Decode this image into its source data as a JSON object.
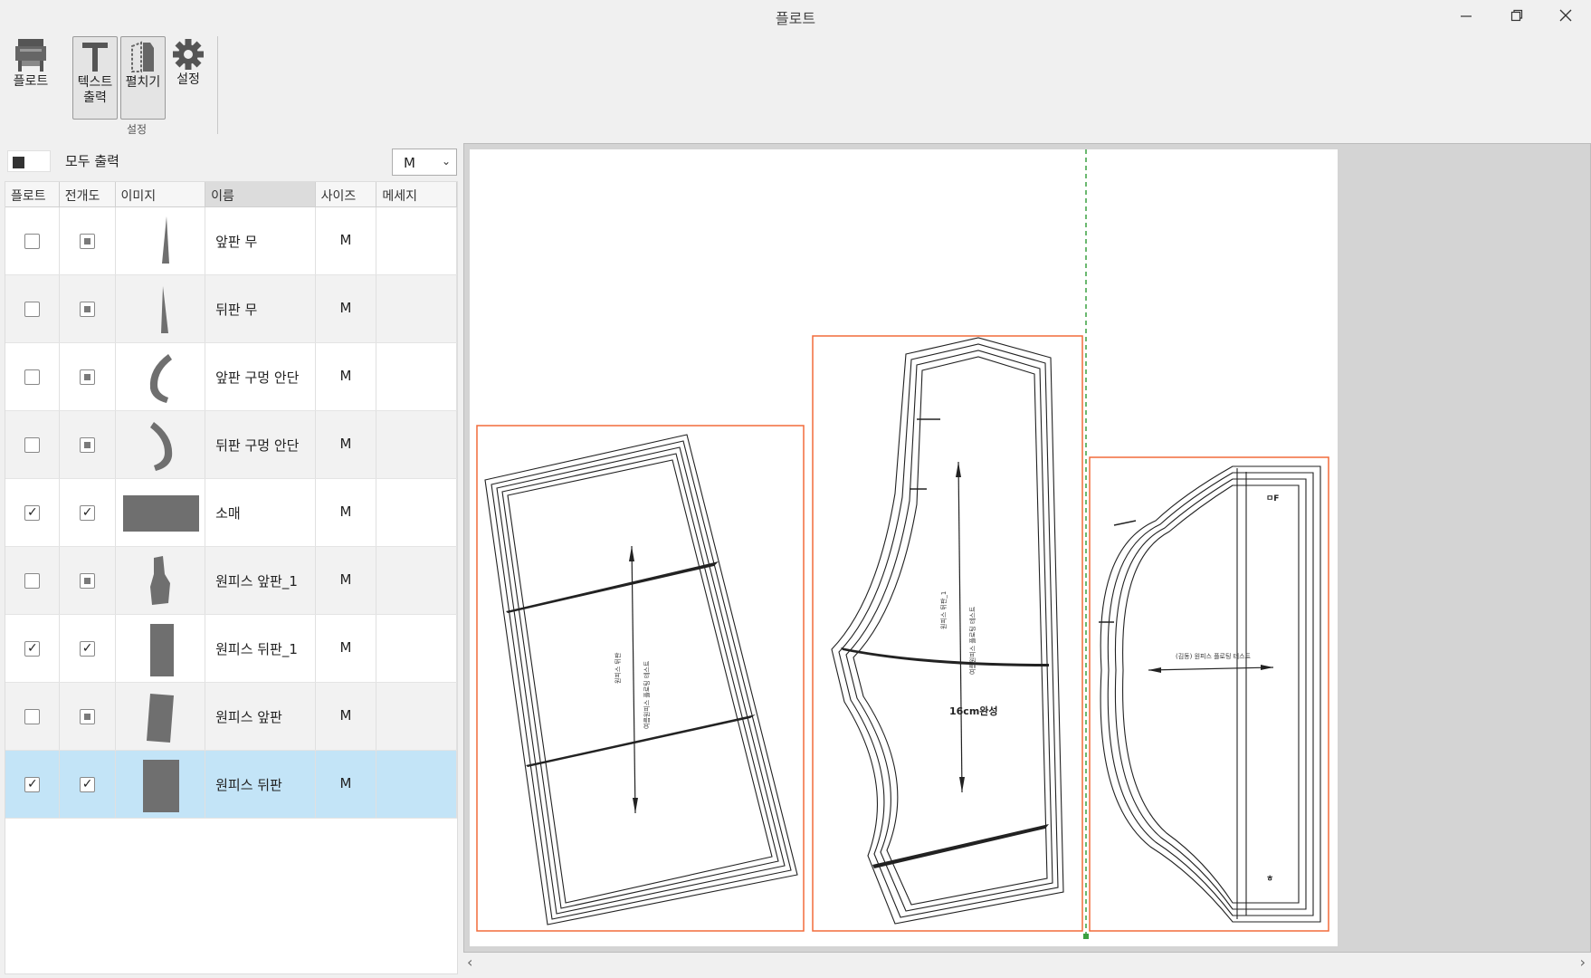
{
  "window": {
    "title": "플로트"
  },
  "ribbon": {
    "plot_label": "플로트",
    "text_output_label_1": "텍스트",
    "text_output_label_2": "출력",
    "unfold_label": "펼치기",
    "settings_label": "설정",
    "group_label": "설정"
  },
  "toolbar": {
    "print_all_label": "모두 출력",
    "size_selected": "M"
  },
  "table": {
    "columns": [
      "플로트",
      "전개도",
      "이미지",
      "이름",
      "사이즈",
      "메세지"
    ],
    "rows": [
      {
        "name": "앞판 무",
        "size": "M",
        "plot": "unchecked",
        "unfold": "indeterminate",
        "thumb": "triangle-tall"
      },
      {
        "name": "뒤판 무",
        "size": "M",
        "plot": "unchecked",
        "unfold": "indeterminate",
        "thumb": "triangle-thin"
      },
      {
        "name": "앞판 구멍 안단",
        "size": "M",
        "plot": "unchecked",
        "unfold": "indeterminate",
        "thumb": "arc-left"
      },
      {
        "name": "뒤판 구멍 안단",
        "size": "M",
        "plot": "unchecked",
        "unfold": "indeterminate",
        "thumb": "arc-right"
      },
      {
        "name": "소매",
        "size": "M",
        "plot": "checked",
        "unfold": "checked",
        "thumb": "wide-rect"
      },
      {
        "name": "원피스 앞판_1",
        "size": "M",
        "plot": "unchecked",
        "unfold": "indeterminate",
        "thumb": "bodice"
      },
      {
        "name": "원피스 뒤판_1",
        "size": "M",
        "plot": "checked",
        "unfold": "checked",
        "thumb": "tall-rect"
      },
      {
        "name": "원피스 앞판",
        "size": "M",
        "plot": "unchecked",
        "unfold": "indeterminate",
        "thumb": "trapezoid"
      },
      {
        "name": "원피스 뒤판",
        "size": "M",
        "plot": "checked",
        "unfold": "checked",
        "thumb": "square-rect"
      }
    ]
  },
  "canvas": {
    "center_label": "16cm완성",
    "piece3_top_mark": "ㅁF",
    "piece3_bottom_mark": "ㅎ"
  },
  "colors": {
    "box": "#f26b3a",
    "guide": "#3aa040",
    "selected_row": "#c3e4f7"
  }
}
